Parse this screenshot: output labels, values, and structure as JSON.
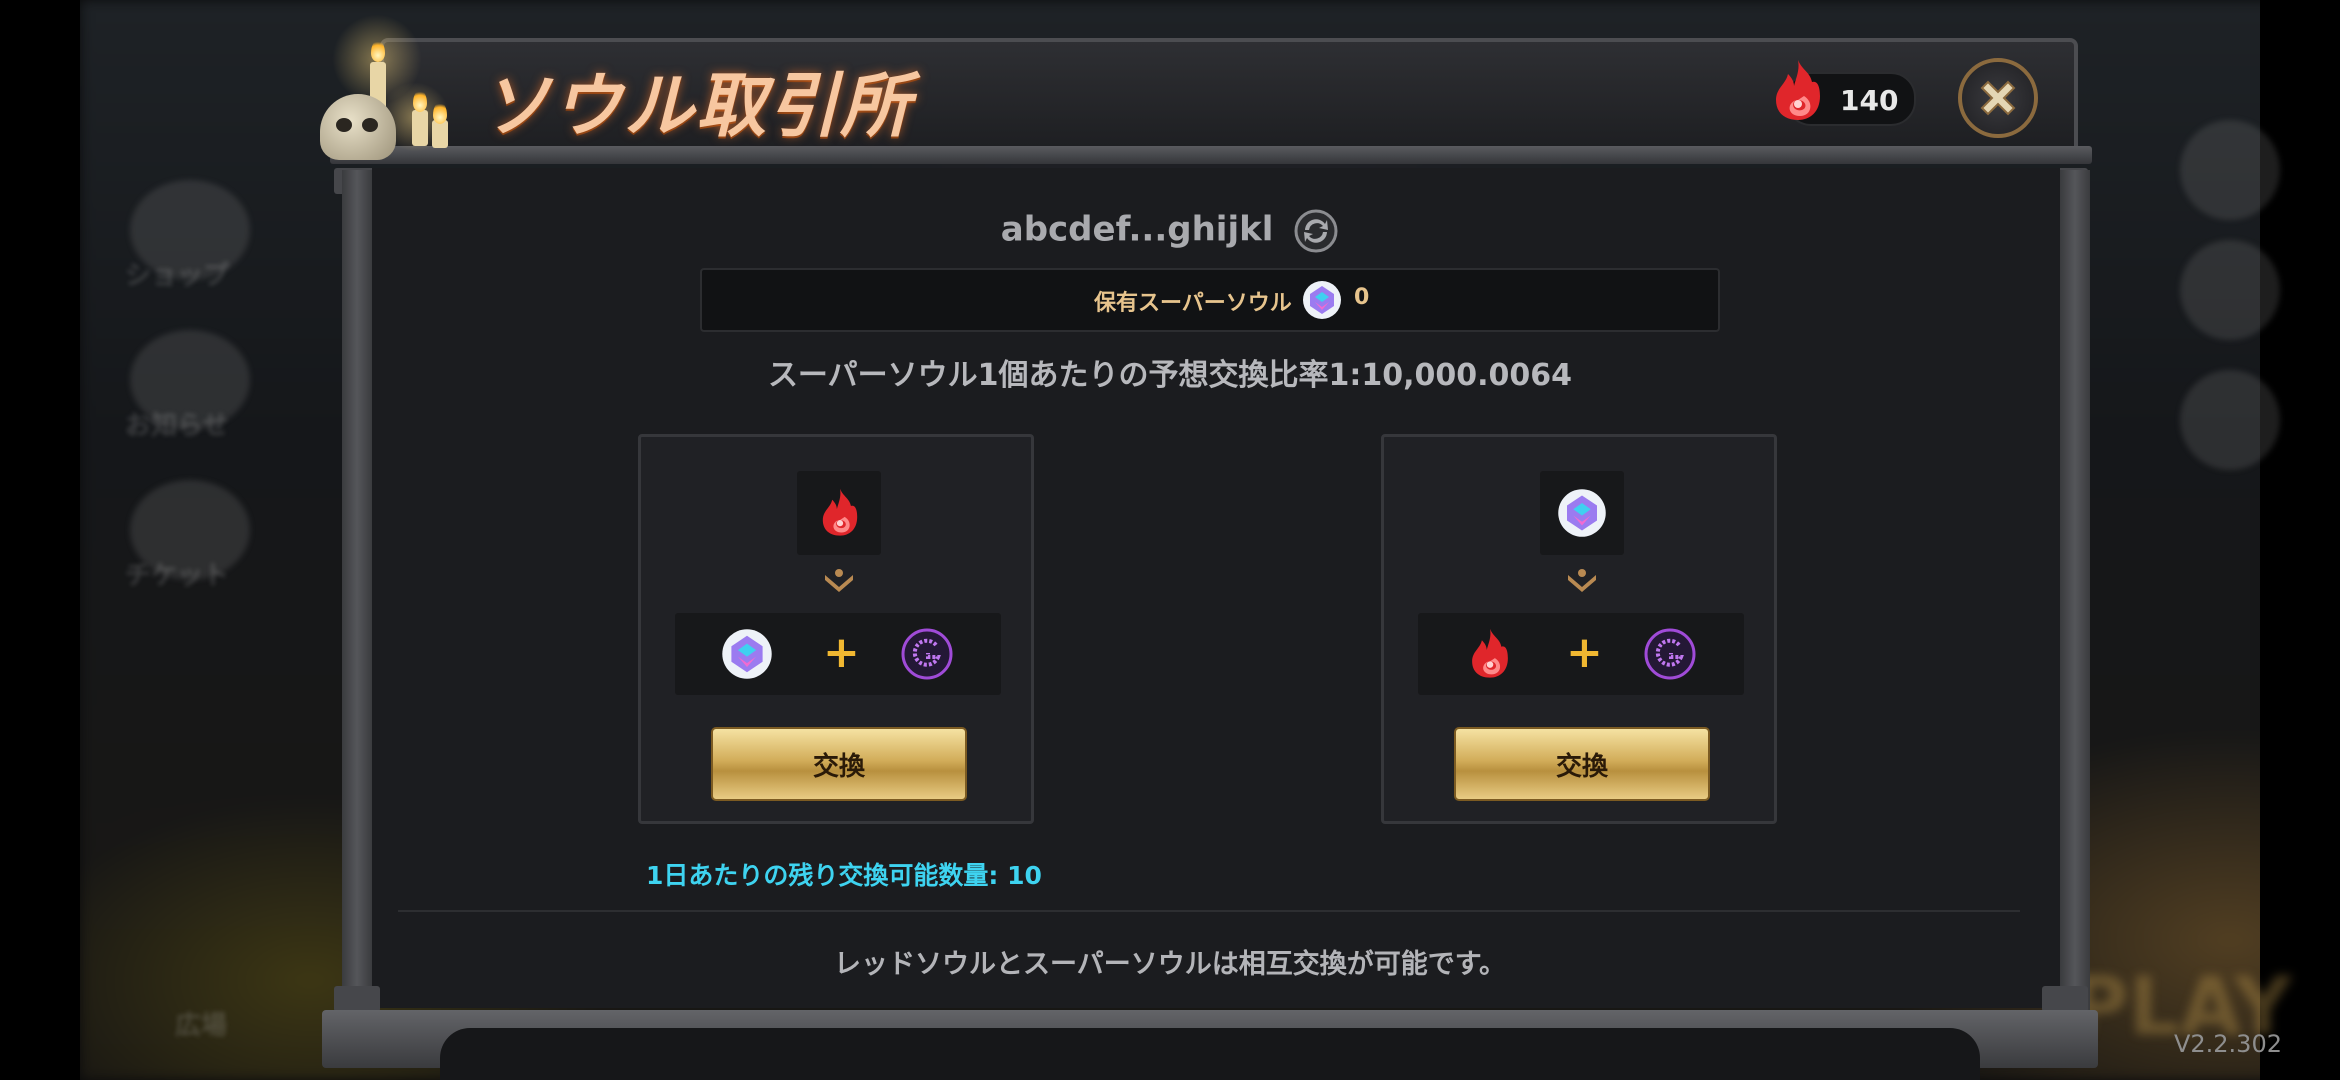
{
  "background": {
    "side_menu": [
      "ショップ",
      "お知らせ",
      "チケット",
      "広場"
    ],
    "version": "V2.2.302"
  },
  "header": {
    "title": "ソウル取引所",
    "red_soul_count": "140"
  },
  "wallet": {
    "address": "abcdef...ghijkl"
  },
  "owned": {
    "label": "保有スーパーソウル",
    "value": "0"
  },
  "rate_text": "スーパーソウル1個あたりの予想交換比率1:10,000.0064",
  "cards": [
    {
      "from": "red-soul",
      "to": [
        "super-soul",
        "g-token"
      ],
      "button_label": "交換"
    },
    {
      "from": "super-soul",
      "to": [
        "red-soul",
        "g-token"
      ],
      "button_label": "交換"
    }
  ],
  "remaining_text": "1日あたりの残り交換可能数量: 10",
  "note_text": "レッドソウルとスーパーソウルは相互交換が可能です。",
  "colors": {
    "title": "#f7c7a0",
    "button_gold": "#d2ad5a",
    "remaining_cyan": "#3ed3f0",
    "owned_label": "#e7c48d",
    "plus": "#f0b731"
  }
}
